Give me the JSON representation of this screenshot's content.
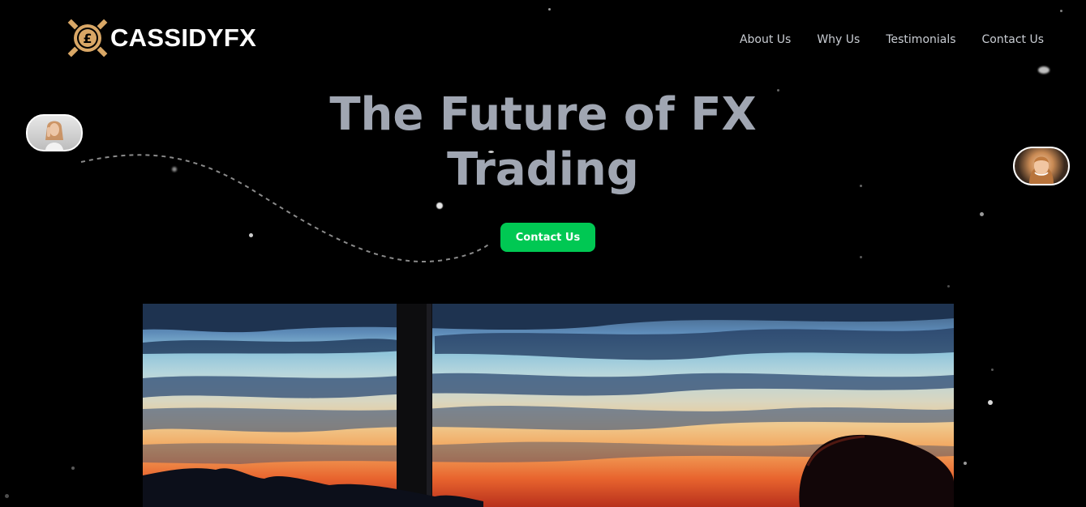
{
  "brand": {
    "name": "CASSIDYFX",
    "logo_icon": "pound-coin-icon",
    "accent_color": "#d9a766"
  },
  "nav": {
    "items": [
      {
        "label": "About Us"
      },
      {
        "label": "Why Us"
      },
      {
        "label": "Testimonials"
      },
      {
        "label": "Contact Us"
      }
    ]
  },
  "hero": {
    "title_line1": "The Future of FX",
    "title_line2": "Trading",
    "cta_label": "Contact Us",
    "cta_color": "#00c853",
    "title_color": "#a0a6b2"
  },
  "avatars": {
    "left": "avatar-woman-surprised",
    "right": "avatar-woman-smiling"
  },
  "video": {
    "scene": "sunset-clouds-video"
  }
}
